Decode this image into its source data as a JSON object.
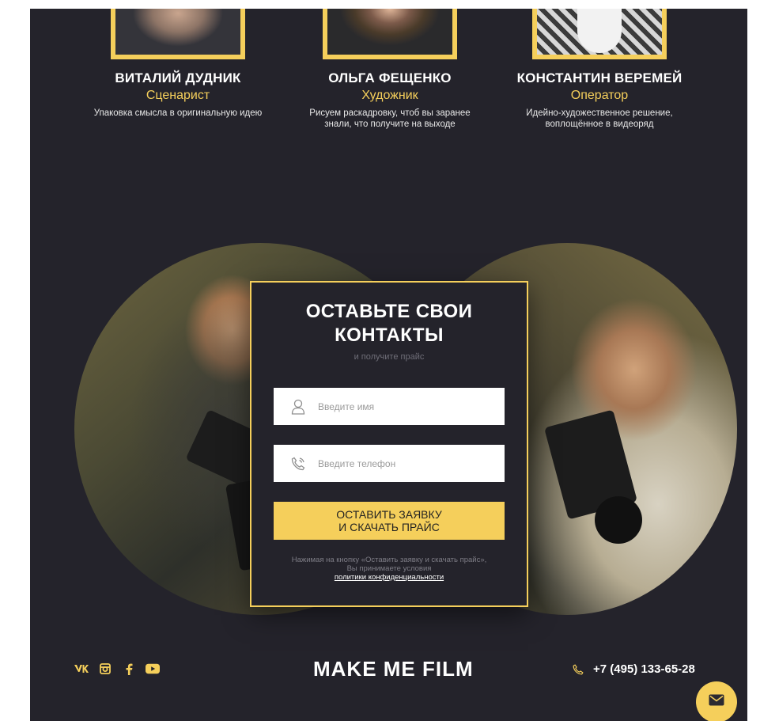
{
  "team": [
    {
      "name": "ВИТАЛИЙ ДУДНИК",
      "role": "Сценарист",
      "desc": "Упаковка смысла в оригинальную идею"
    },
    {
      "name": "ОЛЬГА ФЕЩЕНКО",
      "role": "Художник",
      "desc": "Рисуем раскадровку, чтоб вы заранее знали, что получите на выходе"
    },
    {
      "name": "КОНСТАНТИН ВЕРЕМЕЙ",
      "role": "Оператор",
      "desc": "Идейно-художественное решение, воплощённое в видеоряд"
    }
  ],
  "form": {
    "title_line1": "ОСТАВЬТЕ СВОИ",
    "title_line2": "КОНТАКТЫ",
    "subtitle": "и получите прайс",
    "name_placeholder": "Введите имя",
    "phone_placeholder": "Введите телефон",
    "submit_label": "ОСТАВИТЬ ЗАЯВКУ\nИ СКАЧАТЬ ПРАЙС",
    "consent_line1": "Нажимая на кнопку «Оставить заявку и скачать прайс»,",
    "consent_line2": "Вы принимаете условия",
    "consent_link": "политики конфиденциальности"
  },
  "footer": {
    "socials": [
      {
        "icon": "vk-icon",
        "glyph": "ВК"
      },
      {
        "icon": "instagram-icon",
        "glyph": ""
      },
      {
        "icon": "facebook-icon",
        "glyph": "f"
      },
      {
        "icon": "youtube-icon",
        "glyph": ""
      }
    ],
    "brand": "MAKE ME FILM",
    "phone": "+7 (495) 133-65-28"
  },
  "colors": {
    "accent": "#f5cf5b",
    "background": "#24232b"
  }
}
